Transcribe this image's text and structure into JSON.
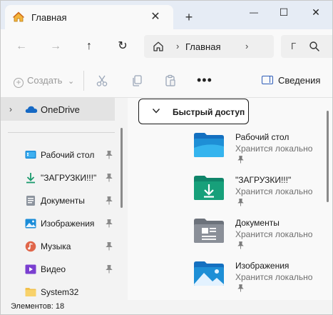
{
  "tab": {
    "title": "Главная",
    "close_glyph": "✕",
    "icon": "home-icon"
  },
  "new_tab_glyph": "+",
  "window_controls": {
    "minimize": "—",
    "maximize": "☐",
    "close": "✕"
  },
  "nav": {
    "back": "←",
    "forward": "→",
    "up": "↑",
    "refresh": "↻",
    "address_separator": "›",
    "breadcrumb": "Главная",
    "search_text": "Г"
  },
  "toolbar": {
    "create_label": "Создать",
    "create_chevron": "⌄",
    "more_label": "•••",
    "details_label": "Сведения"
  },
  "sidebar": {
    "onedrive": {
      "label": "OneDrive",
      "chevron": "›"
    },
    "items": [
      {
        "label": "Рабочий стол",
        "icon": "desktop-icon",
        "pinned": true
      },
      {
        "label": "\"ЗАГРУЗКИ!!!\"",
        "icon": "download-icon",
        "pinned": true
      },
      {
        "label": "Документы",
        "icon": "documents-icon",
        "pinned": true
      },
      {
        "label": "Изображения",
        "icon": "pictures-icon",
        "pinned": true
      },
      {
        "label": "Музыка",
        "icon": "music-icon",
        "pinned": true
      },
      {
        "label": "Видео",
        "icon": "video-icon",
        "pinned": true
      },
      {
        "label": "System32",
        "icon": "folder-icon",
        "pinned": false
      }
    ]
  },
  "content": {
    "section_title": "Быстрый доступ",
    "items": [
      {
        "name": "Рабочий стол",
        "status": "Хранится локально",
        "icon": "desktop-folder-icon"
      },
      {
        "name": "\"ЗАГРУЗКИ!!!\"",
        "status": "Хранится локально",
        "icon": "downloads-folder-icon"
      },
      {
        "name": "Документы",
        "status": "Хранится локально",
        "icon": "documents-folder-icon"
      },
      {
        "name": "Изображения",
        "status": "Хранится локально",
        "icon": "pictures-folder-icon"
      }
    ]
  },
  "status": {
    "items_count": "Элементов: 18"
  },
  "colors": {
    "accent": "#2d5bb8",
    "folder_blue": "#1e8fd6",
    "folder_green": "#17a07a",
    "folder_gray": "#8a8f98"
  }
}
